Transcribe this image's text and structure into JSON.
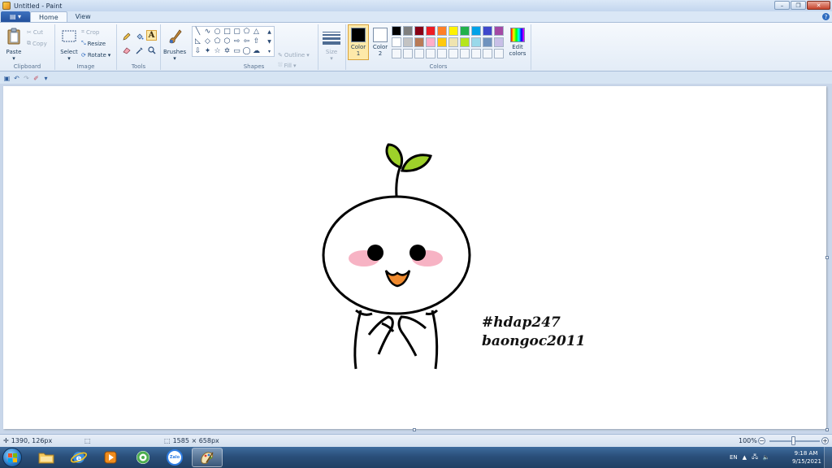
{
  "window": {
    "title": "Untitled - Paint",
    "minimize": "–",
    "maximize": "❐",
    "close": "✕"
  },
  "tabs": {
    "home": "Home",
    "view": "View",
    "help": "?"
  },
  "ribbon": {
    "clipboard": {
      "label": "Clipboard",
      "paste": "Paste",
      "cut": "Cut",
      "copy": "Copy"
    },
    "image": {
      "label": "Image",
      "select": "Select",
      "crop": "Crop",
      "resize": "Resize",
      "rotate": "Rotate"
    },
    "tools": {
      "label": "Tools",
      "brushes": "Brushes"
    },
    "shapes": {
      "label": "Shapes",
      "outline": "Outline",
      "fill": "Fill"
    },
    "size": {
      "label": "Size"
    },
    "colors": {
      "label": "Colors",
      "color1_label": "Color",
      "color1_num": "1",
      "color2_label": "Color",
      "color2_num": "2",
      "edit_label_1": "Edit",
      "edit_label_2": "colors",
      "color1": "#000000",
      "color2": "#ffffff",
      "palette_row1": [
        "#000000",
        "#7f7f7f",
        "#880015",
        "#ed1c24",
        "#ff7f27",
        "#fff200",
        "#22b14c",
        "#00a2e8",
        "#3f48cc",
        "#a349a4"
      ],
      "palette_row2": [
        "#ffffff",
        "#c3c3c3",
        "#b97a57",
        "#ffaec9",
        "#ffc90e",
        "#efe4b0",
        "#b5e61d",
        "#99d9ea",
        "#7092be",
        "#c8bfe7"
      ]
    }
  },
  "canvas": {
    "text_line1": "#hdap247",
    "text_line2": "baongoc2011",
    "drawing_colors": {
      "leaf": "#9ed12a",
      "blush": "#f7b3c4",
      "mouth": "#f08a2e",
      "stroke": "#000000"
    }
  },
  "status": {
    "cursor_pos": "1390, 126px",
    "canvas_size": "1585 × 658px",
    "zoom": "100%"
  },
  "taskbar": {
    "zalo": "Zalo",
    "tray_lang": "EN",
    "time": "9:18 AM",
    "date": "9/15/2021"
  }
}
